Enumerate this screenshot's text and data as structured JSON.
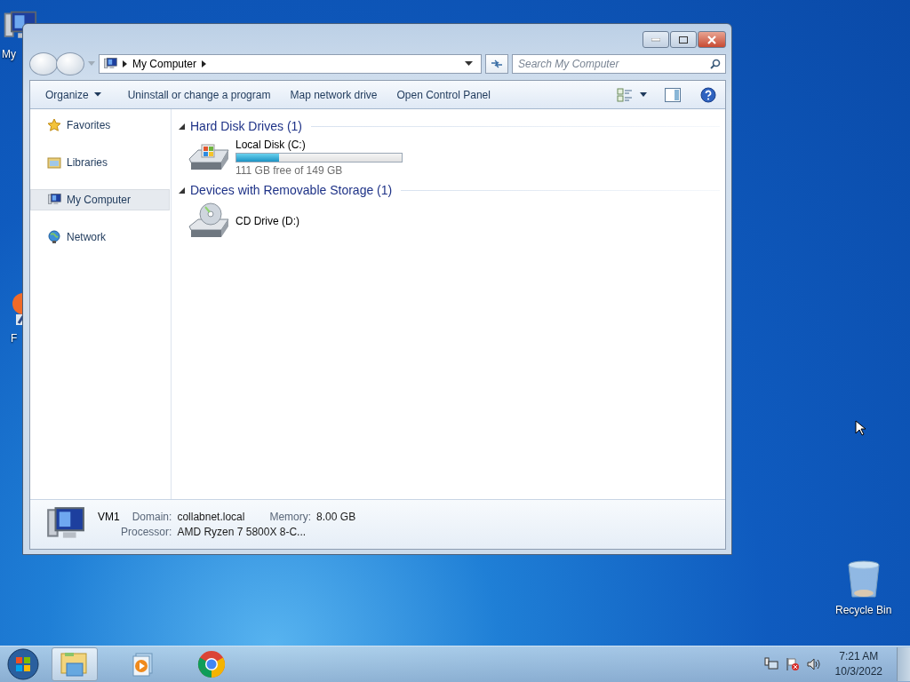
{
  "desktop_icons": [
    {
      "label": "My",
      "kind": "computer"
    },
    {
      "label": "F",
      "kind": "app"
    },
    {
      "label": "Recycle Bin",
      "kind": "bin"
    }
  ],
  "window": {
    "address": {
      "segments": [
        "My Computer"
      ]
    },
    "search": {
      "placeholder": "Search My Computer"
    },
    "toolbar": [
      {
        "label": "Organize",
        "kind": "menu"
      },
      {
        "label": "Uninstall or change a program",
        "kind": "button"
      },
      {
        "label": "Map network drive",
        "kind": "button"
      },
      {
        "label": "Open Control Panel",
        "kind": "button"
      }
    ],
    "nav": [
      {
        "label": "Favorites",
        "kind": "favorites",
        "selected": false
      },
      {
        "label": "Libraries",
        "kind": "libraries",
        "selected": false
      },
      {
        "label": "My Computer",
        "kind": "computer",
        "selected": true
      },
      {
        "label": "Network",
        "kind": "network",
        "selected": false
      }
    ],
    "groups": [
      {
        "title": "Hard Disk Drives (1)",
        "expanded": true,
        "items": [
          {
            "name": "Local Disk (C:)",
            "kind": "disk",
            "level": 0.26,
            "free": "111 GB free of 149 GB"
          }
        ]
      },
      {
        "title": "Devices with Removable Storage (1)",
        "expanded": true,
        "items": [
          {
            "name": "CD Drive (D:)",
            "kind": "cd"
          }
        ]
      }
    ],
    "details": {
      "name": "VM1",
      "fields": [
        {
          "label": "Domain:",
          "value": "collabnet.local"
        },
        {
          "label": "Memory:",
          "value": "8.00 GB"
        },
        {
          "label": "Processor:",
          "value": "AMD Ryzen 7 5800X 8-C..."
        }
      ]
    }
  },
  "taskbar": {
    "apps": [
      {
        "kind": "explorer",
        "selected": true
      },
      {
        "kind": "media",
        "selected": false
      },
      {
        "kind": "chrome",
        "selected": false
      }
    ],
    "clock": {
      "time": "7:21 AM",
      "date": "10/3/2022"
    }
  }
}
